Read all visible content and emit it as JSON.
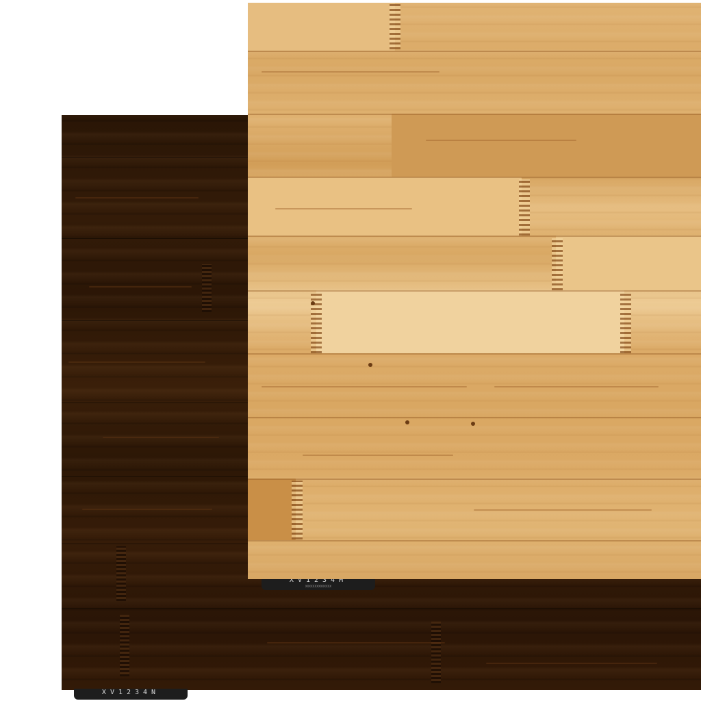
{
  "scene": {
    "background_color": "#ffffff"
  },
  "panels": {
    "dark": {
      "description_color": "#2f1807",
      "label": {
        "code": "XV1234N",
        "fine_print": ""
      }
    },
    "light": {
      "description_color": "#dcae6c",
      "label": {
        "code": "XV1234M",
        "fine_print": "XXXXXXXXXXXXXX"
      }
    }
  }
}
